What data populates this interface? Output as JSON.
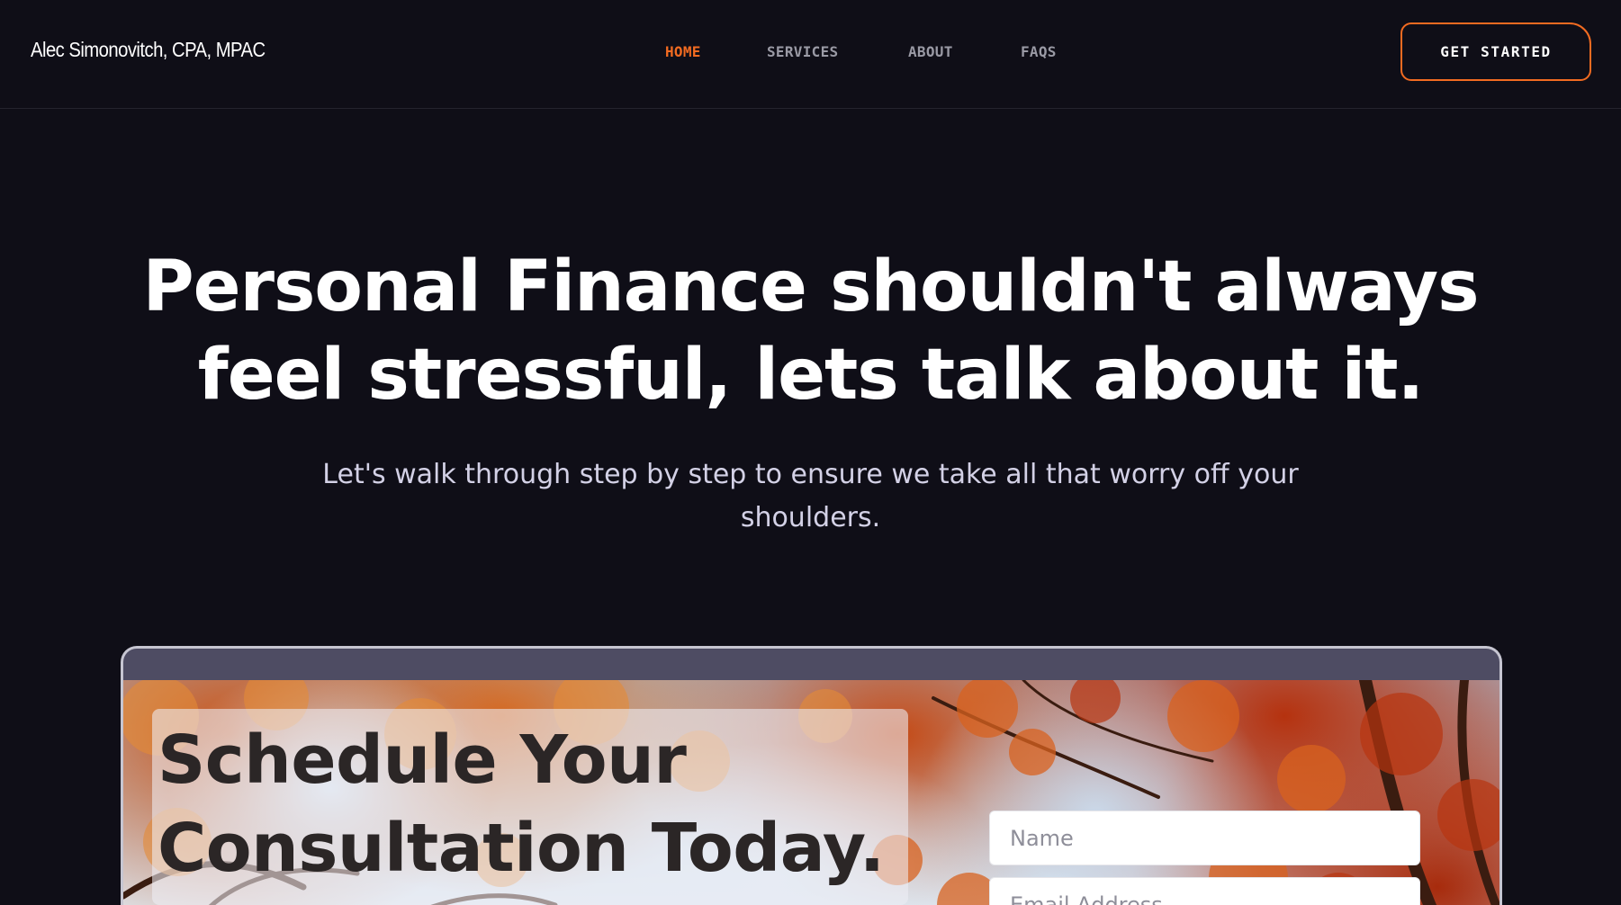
{
  "header": {
    "brand": "Alec Simonovitch, CPA, MPAC",
    "nav": [
      {
        "label": "HOME",
        "active": true
      },
      {
        "label": "SERVICES",
        "active": false
      },
      {
        "label": "ABOUT",
        "active": false
      },
      {
        "label": "FAQS",
        "active": false
      }
    ],
    "cta_label": "GET STARTED"
  },
  "hero": {
    "title_line1": "Personal Finance shouldn't always",
    "title_line2": "feel stressful, lets talk about it.",
    "subtitle_line1": "Let's walk through step by step to ensure we take all that worry off your",
    "subtitle_line2": "shoulders."
  },
  "consultation": {
    "title_line1": "Schedule Your",
    "title_line2": "Consultation Today.",
    "name_placeholder": "Name",
    "email_placeholder": "Email Address"
  },
  "colors": {
    "background": "#0f0e17",
    "accent": "#f26b21",
    "nav_inactive": "#9a9aa5",
    "frame_bar": "#4e4c63"
  }
}
